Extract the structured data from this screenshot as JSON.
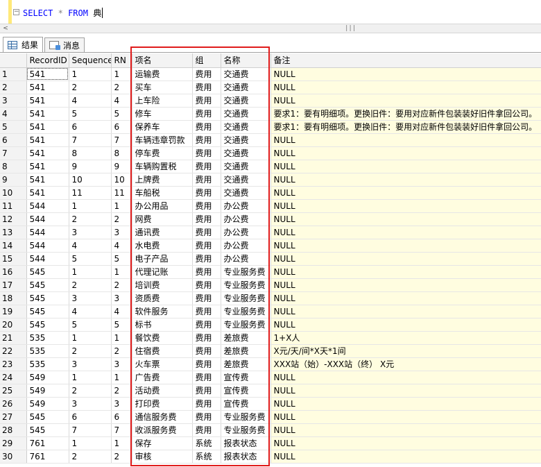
{
  "editor": {
    "sql_select": "SELECT",
    "sql_star": "*",
    "sql_from": "FROM",
    "sql_table": "典"
  },
  "tabs": [
    {
      "label": "结果",
      "icon": "results-grid-icon",
      "active": true
    },
    {
      "label": "消息",
      "icon": "messages-icon",
      "active": false
    }
  ],
  "grid": {
    "columns": [
      "",
      "RecordID",
      "Sequence",
      "RN",
      "项名",
      "组",
      "名称",
      "备注"
    ],
    "rows": [
      [
        "1",
        "541",
        "1",
        "1",
        "运输费",
        "费用",
        "交通费",
        "NULL"
      ],
      [
        "2",
        "541",
        "2",
        "2",
        "买车",
        "费用",
        "交通费",
        "NULL"
      ],
      [
        "3",
        "541",
        "4",
        "4",
        "上车险",
        "费用",
        "交通费",
        "NULL"
      ],
      [
        "4",
        "541",
        "5",
        "5",
        "修车",
        "费用",
        "交通费",
        "要求1：要有明细项。更换旧件：要用对应新件包装装好旧件拿回公司。"
      ],
      [
        "5",
        "541",
        "6",
        "6",
        "保养车",
        "费用",
        "交通费",
        "要求1：要有明细项。更换旧件：要用对应新件包装装好旧件拿回公司。"
      ],
      [
        "6",
        "541",
        "7",
        "7",
        "车辆违章罚款",
        "费用",
        "交通费",
        "NULL"
      ],
      [
        "7",
        "541",
        "8",
        "8",
        "停车费",
        "费用",
        "交通费",
        "NULL"
      ],
      [
        "8",
        "541",
        "9",
        "9",
        "车辆购置税",
        "费用",
        "交通费",
        "NULL"
      ],
      [
        "9",
        "541",
        "10",
        "10",
        "上牌费",
        "费用",
        "交通费",
        "NULL"
      ],
      [
        "10",
        "541",
        "11",
        "11",
        "车船税",
        "费用",
        "交通费",
        "NULL"
      ],
      [
        "11",
        "544",
        "1",
        "1",
        "办公用品",
        "费用",
        "办公费",
        "NULL"
      ],
      [
        "12",
        "544",
        "2",
        "2",
        "网费",
        "费用",
        "办公费",
        "NULL"
      ],
      [
        "13",
        "544",
        "3",
        "3",
        "通讯费",
        "费用",
        "办公费",
        "NULL"
      ],
      [
        "14",
        "544",
        "4",
        "4",
        "水电费",
        "费用",
        "办公费",
        "NULL"
      ],
      [
        "15",
        "544",
        "5",
        "5",
        "电子产品",
        "费用",
        "办公费",
        "NULL"
      ],
      [
        "16",
        "545",
        "1",
        "1",
        "代理记账",
        "费用",
        "专业服务费",
        "NULL"
      ],
      [
        "17",
        "545",
        "2",
        "2",
        "培训费",
        "费用",
        "专业服务费",
        "NULL"
      ],
      [
        "18",
        "545",
        "3",
        "3",
        "资质费",
        "费用",
        "专业服务费",
        "NULL"
      ],
      [
        "19",
        "545",
        "4",
        "4",
        "软件服务",
        "费用",
        "专业服务费",
        "NULL"
      ],
      [
        "20",
        "545",
        "5",
        "5",
        "标书",
        "费用",
        "专业服务费",
        "NULL"
      ],
      [
        "21",
        "535",
        "1",
        "1",
        "餐饮费",
        "费用",
        "差旅费",
        "1+X人"
      ],
      [
        "22",
        "535",
        "2",
        "2",
        "住宿费",
        "费用",
        "差旅费",
        "X元/天/间*X天*1间"
      ],
      [
        "23",
        "535",
        "3",
        "3",
        "火车票",
        "费用",
        "差旅费",
        "XXX站（始）-XXX站（终） X元"
      ],
      [
        "24",
        "549",
        "1",
        "1",
        "广告费",
        "费用",
        "宣传费",
        "NULL"
      ],
      [
        "25",
        "549",
        "2",
        "2",
        "活动费",
        "费用",
        "宣传费",
        "NULL"
      ],
      [
        "26",
        "549",
        "3",
        "3",
        "打印费",
        "费用",
        "宣传费",
        "NULL"
      ],
      [
        "27",
        "545",
        "6",
        "6",
        "通信服务费",
        "费用",
        "专业服务费",
        "NULL"
      ],
      [
        "28",
        "545",
        "7",
        "7",
        "收派服务费",
        "费用",
        "专业服务费",
        "NULL"
      ],
      [
        "29",
        "761",
        "1",
        "1",
        "保存",
        "系统",
        "报表状态",
        "NULL"
      ],
      [
        "30",
        "761",
        "2",
        "2",
        "审核",
        "系统",
        "报表状态",
        "NULL"
      ]
    ]
  },
  "colors": {
    "highlight_border": "#e01b1b",
    "note_column_bg": "#fffde0",
    "keyword": "#0000ff"
  }
}
